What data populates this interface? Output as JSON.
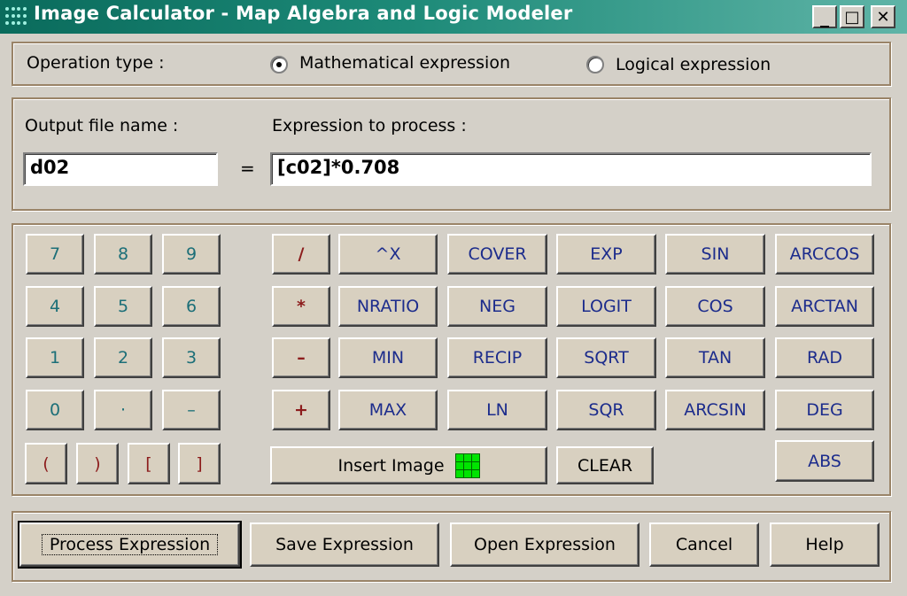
{
  "window": {
    "title": "Image Calculator - Map  Algebra and Logic Modeler",
    "minimize": "_",
    "maximize": "□",
    "close": "✕"
  },
  "operation": {
    "label": "Operation type :",
    "options": [
      "Mathematical expression",
      "Logical expression"
    ],
    "selected": "Mathematical expression"
  },
  "output": {
    "label": "Output file name :",
    "value": "d02"
  },
  "equals": "=",
  "expression": {
    "label": "Expression to process :",
    "value": "[c02]*0.708"
  },
  "keypad": {
    "digits": [
      "7",
      "8",
      "9",
      "4",
      "5",
      "6",
      "1",
      "2",
      "3",
      "0",
      "·",
      "–"
    ],
    "brackets": [
      "(",
      ")",
      "[",
      "]"
    ]
  },
  "operators": [
    "/",
    "*",
    "–",
    "+"
  ],
  "functions": [
    [
      "^X",
      "COVER",
      "EXP",
      "SIN",
      "ARCCOS"
    ],
    [
      "NRATIO",
      "NEG",
      "LOGIT",
      "COS",
      "ARCTAN"
    ],
    [
      "MIN",
      "RECIP",
      "SQRT",
      "TAN",
      "RAD"
    ],
    [
      "MAX",
      "LN",
      "SQR",
      "ARCSIN",
      "DEG"
    ]
  ],
  "insert_image": "Insert Image",
  "clear": "CLEAR",
  "abs": "ABS",
  "actions": {
    "process": "Process Expression",
    "save": "Save Expression",
    "open": "Open Expression",
    "cancel": "Cancel",
    "help": "Help"
  },
  "colors": {
    "titlebar": "#0a6b5c",
    "face": "#d4d0c8",
    "button_face": "#d8d0c0",
    "function_text": "#1c2c8c",
    "digit_text": "#1c6f78",
    "operator_text": "#8c1c1c"
  }
}
